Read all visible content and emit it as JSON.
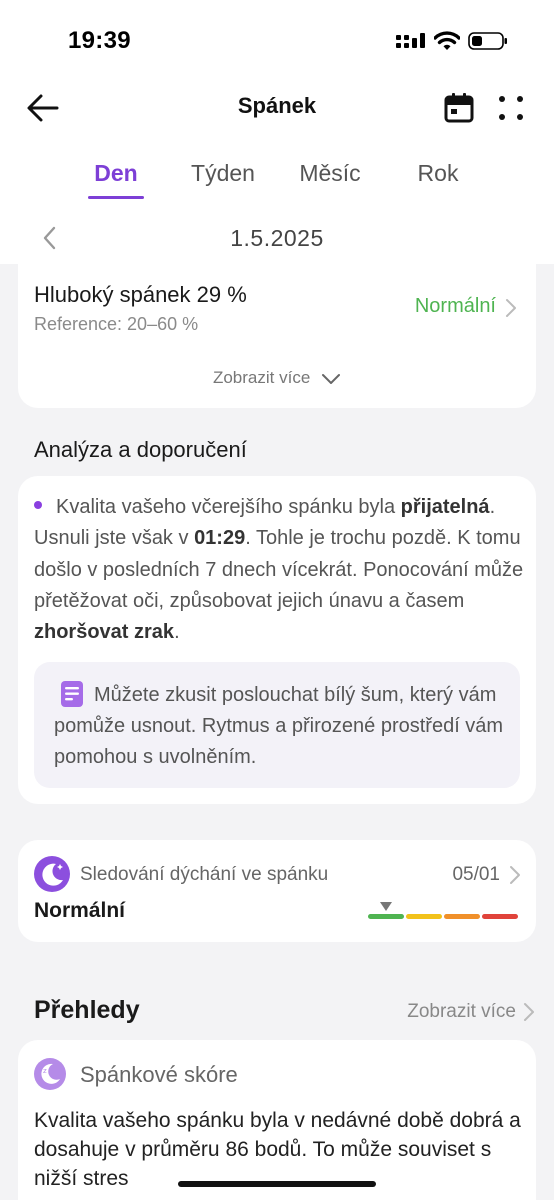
{
  "status_bar": {
    "time": "19:39"
  },
  "header": {
    "title": "Spánek"
  },
  "tabs": [
    {
      "label": "Den",
      "active": true
    },
    {
      "label": "Týden",
      "active": false
    },
    {
      "label": "Měsíc",
      "active": false
    },
    {
      "label": "Rok",
      "active": false
    }
  ],
  "date_nav": {
    "date": "1.5.2025"
  },
  "deep_sleep": {
    "title": "Hluboký spánek 29 %",
    "reference": "Reference: 20–60 %",
    "status": "Normální",
    "more_label": "Zobrazit více"
  },
  "analysis": {
    "section_title": "Analýza a doporučení",
    "parts": [
      "Kvalita vašeho včerejšího spánku byla ",
      "přijatelná",
      ". Usnuli jste však v ",
      "01:29",
      ". Tohle je trochu pozdě. K tomu došlo v posledních 7 dnech vícekrát. Ponocování může přetěžovat oči, způsobovat jejich únavu a časem ",
      "zhoršovat zrak",
      "."
    ],
    "tip": "Můžete zkusit poslouchat bílý šum, který vám pomůže usnout. Rytmus a přirozené prostředí vám pomohou s uvolněním."
  },
  "breathing": {
    "label": "Sledování dýchání ve spánku",
    "date": "05/01",
    "value": "Normální",
    "scale_level": "normal"
  },
  "overview": {
    "title": "Přehledy",
    "more_label": "Zobrazit více"
  },
  "sleep_score": {
    "label": "Spánkové skóre",
    "text": "Kvalita vašeho spánku byla v nedávné době dobrá a dosahuje v průměru 86 bodů. To může souviset s nižší stres"
  },
  "colors": {
    "accent": "#7d3fd6",
    "normal_green": "#4fb451",
    "scale": [
      "#4fb451",
      "#f2c21b",
      "#f0902a",
      "#e0433b"
    ]
  }
}
